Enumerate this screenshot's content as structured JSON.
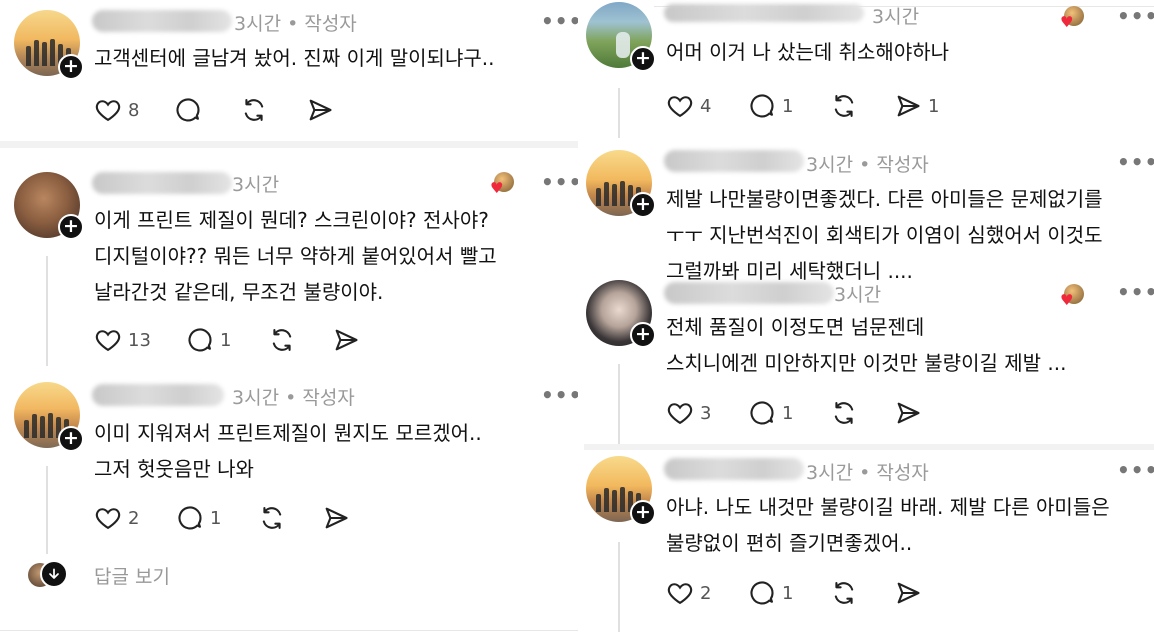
{
  "common": {
    "time_author": "3시간 • 작성자",
    "time_only": "3시간",
    "more": "•••",
    "plus": "+",
    "heart": "♥",
    "reply_icon": "arrow-down-icon",
    "show_replies": "답글 보기"
  },
  "left": {
    "posts": [
      {
        "meta": "3시간 • 작성자",
        "lines": [
          "고객센터에 글남겨 놨어. 진짜 이게 말이되냐구.."
        ],
        "likes": "8",
        "comments": ""
      },
      {
        "meta": "3시간",
        "lines": [
          "이게 프린트 제질이 뭔데? 스크린이야? 전사야?",
          "디지털이야?? 뭐든 너무 약하게 붙어있어서 빨고",
          "날라간것 같은데, 무조건 불량이야."
        ],
        "likes": "13",
        "comments": "1"
      },
      {
        "meta": "3시간 • 작성자",
        "lines": [
          "이미 지워져서 프린트제질이 뭔지도 모르겠어..",
          "그저 헛웃음만 나와"
        ],
        "likes": "2",
        "comments": "1"
      }
    ]
  },
  "right": {
    "posts": [
      {
        "meta": "3시간",
        "lines": [
          "어머 이거 나 샀는데 취소해야하나"
        ],
        "likes": "4",
        "comments": "1",
        "reposts": "1"
      },
      {
        "meta": "3시간 • 작성자",
        "lines": [
          "제발 나만불량이면좋겠다. 다른 아미들은 문제없기를",
          "ㅜㅜ 지난번석진이 회색티가 이염이 심했어서 이것도",
          "그럴까봐 미리 세탁했더니 ...."
        ]
      },
      {
        "meta": "3시간",
        "lines": [
          "전체 품질이 이정도면 넘문젠데",
          "스치니에겐 미안하지만 이것만  불량이길 제발 ..."
        ],
        "likes": "3",
        "comments": "1"
      },
      {
        "meta": "3시간 • 작성자",
        "lines": [
          "아냐. 나도 내것만  불량이길 바래. 제발 다른 아미들은",
          "불량없이 편히 즐기면좋겠어.."
        ],
        "likes": "2",
        "comments": "1"
      }
    ]
  },
  "colors": {
    "heart": "#f0283c",
    "meta": "#9a9a9a",
    "divider": "#e7e7e7"
  }
}
